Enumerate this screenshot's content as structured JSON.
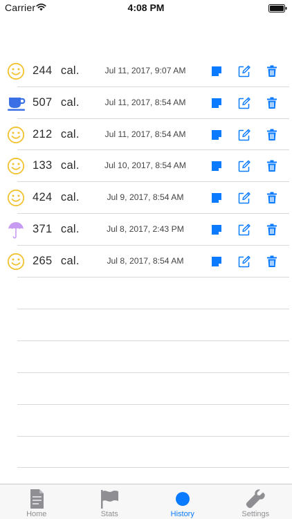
{
  "status_bar": {
    "carrier": "Carrier",
    "time": "4:08 PM"
  },
  "entries": [
    {
      "mood": "smiley",
      "calories": "244",
      "unit": "cal.",
      "datetime": "Jul 11, 2017, 9:07 AM"
    },
    {
      "mood": "coffee",
      "calories": "507",
      "unit": "cal.",
      "datetime": "Jul 11, 2017, 8:54 AM"
    },
    {
      "mood": "smiley",
      "calories": "212",
      "unit": "cal.",
      "datetime": "Jul 11, 2017, 8:54 AM"
    },
    {
      "mood": "smiley",
      "calories": "133",
      "unit": "cal.",
      "datetime": "Jul 10, 2017, 8:54 AM"
    },
    {
      "mood": "smiley",
      "calories": "424",
      "unit": "cal.",
      "datetime": "Jul 9, 2017, 8:54 AM"
    },
    {
      "mood": "umbrella",
      "calories": "371",
      "unit": "cal.",
      "datetime": "Jul 8, 2017, 2:43 PM"
    },
    {
      "mood": "smiley",
      "calories": "265",
      "unit": "cal.",
      "datetime": "Jul 8, 2017, 8:54 AM"
    }
  ],
  "row_actions": [
    {
      "name": "note-icon",
      "color": "#0a7aff"
    },
    {
      "name": "edit-icon",
      "color": "#0a7aff"
    },
    {
      "name": "trash-icon",
      "color": "#0a7aff"
    }
  ],
  "tabs": [
    {
      "label": "Home",
      "icon": "document-icon",
      "active": false
    },
    {
      "label": "Stats",
      "icon": "flag-icon",
      "active": false
    },
    {
      "label": "History",
      "icon": "circle-icon",
      "active": true
    },
    {
      "label": "Settings",
      "icon": "wrench-icon",
      "active": false
    }
  ],
  "colors": {
    "accent": "#0a7aff",
    "smiley": "#f2c230",
    "coffee": "#3a6fe6",
    "umbrella": "#c89bf2",
    "tab_inactive": "#9a9a9e",
    "separator": "#d8d8dc"
  }
}
